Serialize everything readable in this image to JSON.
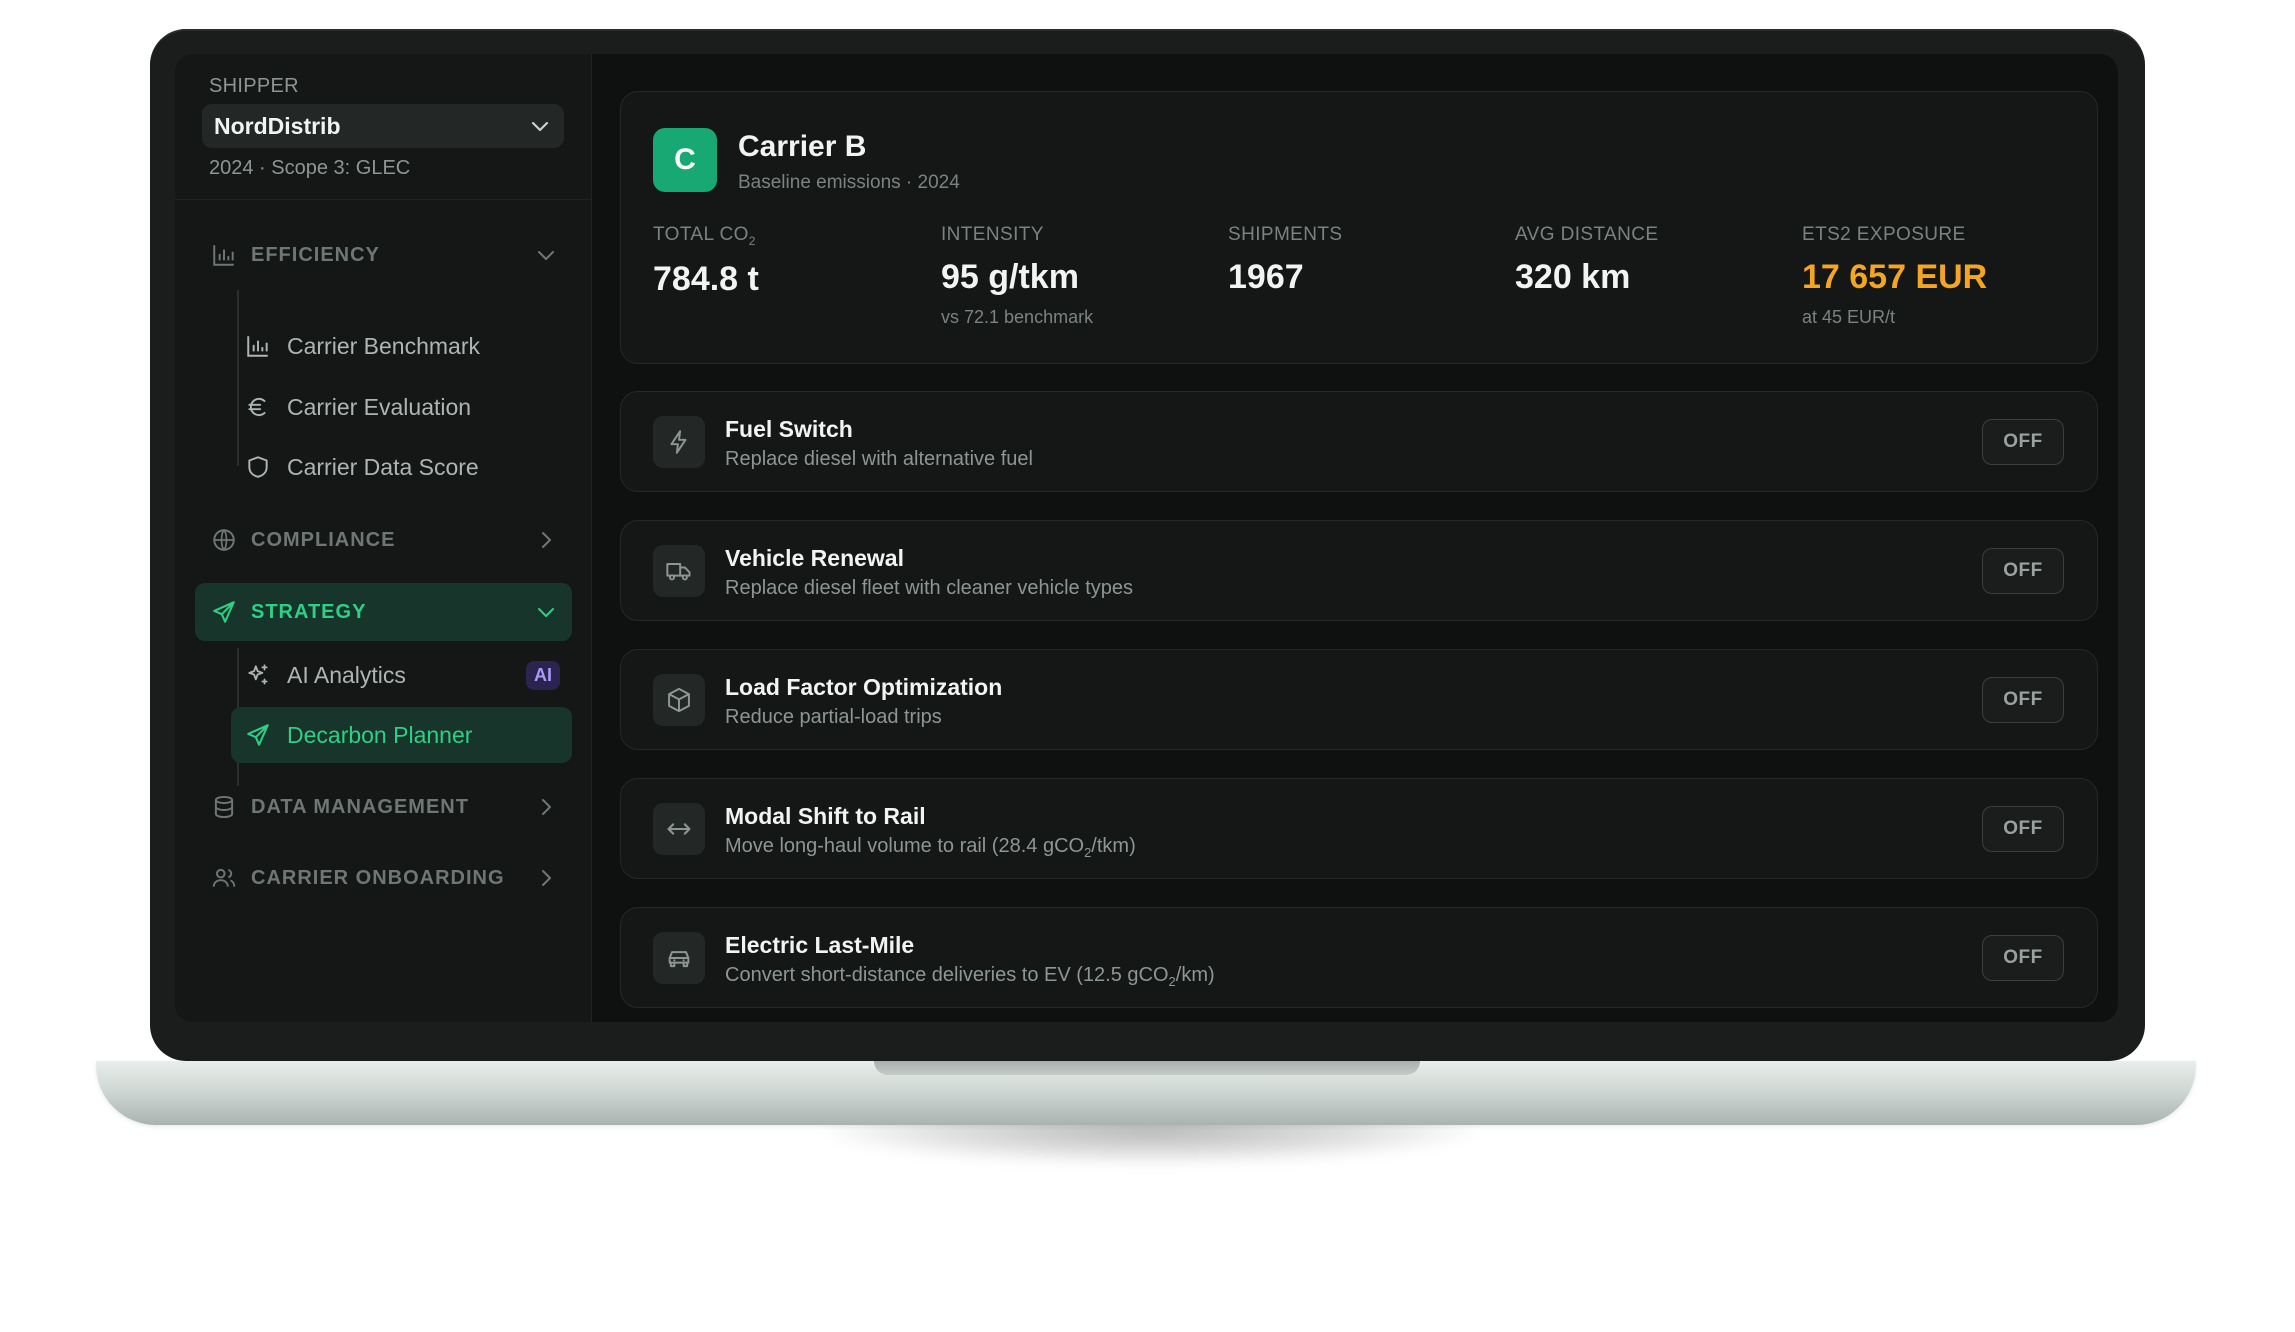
{
  "sidebar": {
    "shipper_label": "SHIPPER",
    "shipper_value": "NordDistrib",
    "shipper_sub": "2024 · Scope 3: GLEC",
    "sections": {
      "efficiency": {
        "label": "EFFICIENCY",
        "items": [
          "Carrier Benchmark",
          "Carrier Evaluation",
          "Carrier Data Score"
        ]
      },
      "compliance": {
        "label": "COMPLIANCE"
      },
      "strategy": {
        "label": "STRATEGY",
        "items": [
          "AI Analytics",
          "Decarbon Planner"
        ],
        "ai_badge": "AI"
      },
      "data_management": {
        "label": "DATA MANAGEMENT"
      },
      "carrier_onboarding": {
        "label": "CARRIER ONBOARDING"
      }
    }
  },
  "carrier": {
    "initial": "C",
    "name": "Carrier B",
    "subtitle": "Baseline emissions · 2024",
    "stats": {
      "total_co2": {
        "label_main": "TOTAL CO",
        "label_sub": "2",
        "value": "784.8 t"
      },
      "intensity": {
        "label": "INTENSITY",
        "value": "95 g/tkm",
        "note": "vs 72.1 benchmark"
      },
      "shipments": {
        "label": "SHIPMENTS",
        "value": "1967"
      },
      "avg_distance": {
        "label": "AVG DISTANCE",
        "value": "320 km"
      },
      "ets2": {
        "label": "ETS2 EXPOSURE",
        "value": "17 657 EUR",
        "note": "at 45 EUR/t"
      }
    }
  },
  "levers": [
    {
      "title": "Fuel Switch",
      "desc": "Replace diesel with alternative fuel",
      "state": "OFF",
      "icon": "bolt-icon"
    },
    {
      "title": "Vehicle Renewal",
      "desc": "Replace diesel fleet with cleaner vehicle types",
      "state": "OFF",
      "icon": "truck-icon"
    },
    {
      "title": "Load Factor Optimization",
      "desc": "Reduce partial-load trips",
      "state": "OFF",
      "icon": "box-icon"
    },
    {
      "title": "Modal Shift to Rail",
      "desc_pre": "Move long-haul volume to rail (28.4 gCO",
      "desc_sub": "2",
      "desc_post": "/tkm)",
      "state": "OFF",
      "icon": "arrows-horizontal-icon"
    },
    {
      "title": "Electric Last-Mile",
      "desc_pre": "Convert short-distance deliveries to EV (12.5 gCO",
      "desc_sub": "2",
      "desc_post": "/km)",
      "state": "OFF",
      "icon": "car-icon"
    }
  ],
  "colors": {
    "accent": "#2fcf85",
    "warning": "#f5a524",
    "avatar": "#17a874"
  }
}
